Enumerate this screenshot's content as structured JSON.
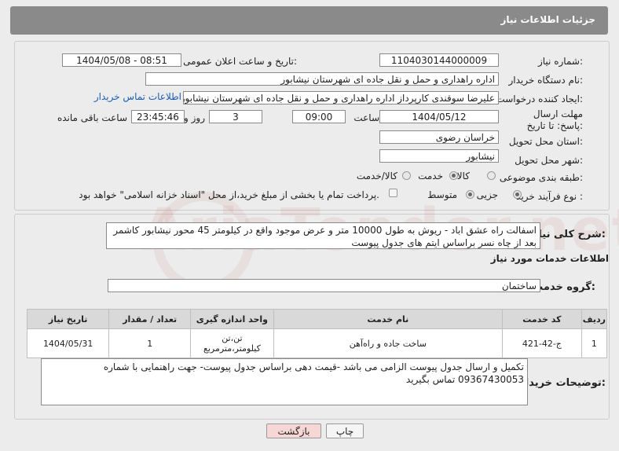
{
  "header": {
    "title": "جزئیات اطلاعات نیاز"
  },
  "fields": {
    "need_number_label": "شماره نیاز:",
    "need_number": "1104030144000009",
    "announce_label": "تاریخ و ساعت اعلان عمومی:",
    "announce_value": "1404/05/08 - 08:51",
    "buyer_org_label": "نام دستگاه خریدار:",
    "buyer_org": "اداره راهداری و حمل و نقل جاده ای شهرستان نیشابور",
    "creator_label": "ایجاد کننده درخواست:",
    "creator": "علیرضا سوقندی کارپرداز اداره راهداری و حمل و نقل جاده ای شهرستان نیشابور",
    "contact_link": "اطلاعات تماس خریدار",
    "deadline_label": "مهلت ارسال پاسخ: تا تاریخ:",
    "deadline_date": "1404/05/12",
    "time_label": "ساعت",
    "deadline_time": "09:00",
    "days": "3",
    "days_label": "روز و",
    "remaining": "23:45:46",
    "remaining_label": "ساعت باقی مانده",
    "province_label": "استان محل تحویل:",
    "province": "خراسان رضوی",
    "city_label": "شهر محل تحویل:",
    "city": "نیشابور",
    "category_label": "طبقه بندی موضوعی:",
    "cat_goods": "کالا",
    "cat_service": "خدمت",
    "cat_both": "کالا/خدمت",
    "process_label": "نوع فرآیند خرید :",
    "proc_small": "جزیی",
    "proc_medium": "متوسط",
    "payment_note": "پرداخت تمام یا بخشی از مبلغ خرید،از محل \"اسناد خزانه اسلامی\" خواهد بود."
  },
  "desc": {
    "label": "شرح کلی نیاز:",
    "text": "اسفالت راه عشق اباد - ریوش  به طول 10000 متر  و عرض موجود واقع در کیلومتر 45 محور نیشابور کاشمر بعد از چاه نسر براساس ایتم های جدول پیوست"
  },
  "services": {
    "title": "اطلاعات خدمات مورد نیاز",
    "group_label": "گروه خدمت:",
    "group": "ساختمان",
    "columns": [
      "ردیف",
      "کد خدمت",
      "نام خدمت",
      "واحد اندازه گیری",
      "تعداد / مقدار",
      "تاریخ نیاز"
    ],
    "rows": [
      {
        "idx": "1",
        "code": "ج-42-421",
        "name": "ساخت جاده و راه‌آهن",
        "unit1": "تن،تن",
        "unit2": "کیلومتر،مترمربع",
        "qty": "1",
        "date": "1404/05/31"
      }
    ]
  },
  "notes": {
    "label": "توضیحات خریدار:",
    "text": "تکمیل و ارسال جدول پیوست الزامی می باشد -قیمت دهی براساس جدول پیوست- جهت راهنمایی با شماره 09367430053 تماس بگیرید"
  },
  "buttons": {
    "print": "چاپ",
    "back": "بازگشت"
  },
  "colors": {
    "header_bg": "#8a8a8a",
    "back_btn_bg": "#f7d6d6",
    "link": "#1a5fb4"
  }
}
